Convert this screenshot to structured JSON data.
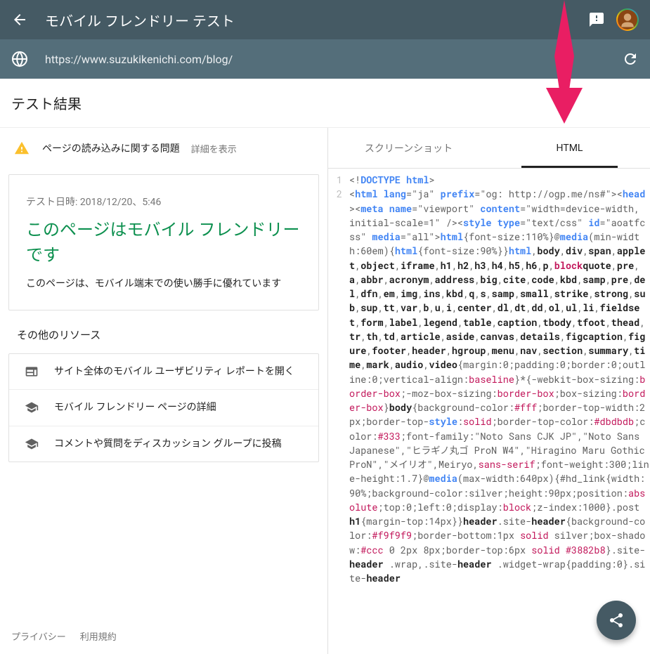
{
  "header": {
    "title": "モバイル フレンドリー テスト"
  },
  "url": "https://www.suzukikenichi.com/blog/",
  "result_header": "テスト結果",
  "warning": {
    "label": "ページの読み込みに関する問題",
    "details": "詳細を表示"
  },
  "card": {
    "date": "テスト日時: 2018/12/20、5:46",
    "msg": "このページはモバイル フレンドリーです",
    "desc": "このページは、モバイル端末での使い勝手に優れています"
  },
  "resources_title": "その他のリソース",
  "resources": [
    "サイト全体のモバイル ユーザビリティ レポートを開く",
    "モバイル フレンドリー ページの詳細",
    "コメントや質問をディスカッション グループに投稿"
  ],
  "footer": {
    "privacy": "プライバシー",
    "tos": "利用規約"
  },
  "tabs": {
    "screenshot": "スクリーンショット",
    "html": "HTML"
  },
  "code_lines": [
    "1",
    "2"
  ],
  "source_preview": "<!DOCTYPE html>\n<html lang=\"ja\" prefix=\"og: http://ogp.me/ns#\"><head><meta name=\"viewport\" content=\"width=device-width, initial-scale=1\" /><style type=\"text/css\" id=\"aoatfcss\" media=\"all\">html{font-size:110%}@media(min-width:60em){html{font-size:90%}}html,body,div,span,applet,object,iframe,h1,h2,h3,h4,h5,h6,p,blockquote,pre,a,abbr,acronym,address,big,cite,code,kbd,samp,pre,del,dfn,em,img,ins,kbd,q,s,samp,small,strike,strong,sub,sup,tt,var,b,u,i,center,dl,dt,dd,ol,ul,li,fieldset,form,label,legend,table,caption,tbody,tfoot,thead,tr,th,td,article,aside,canvas,details,figcaption,figure,footer,header,hgroup,menu,nav,section,summary,time,mark,audio,video{margin:0;padding:0;border:0;outline:0;vertical-align:baseline}*{-webkit-box-sizing:border-box;-moz-box-sizing:border-box;box-sizing:border-box}body{background-color:#fff;border-top-width:2px;border-top-style:solid;border-top-color:#dbdbdb;color:#333;font-family:\"Noto Sans CJK JP\",\"Noto Sans Japanese\",\"ヒラギノ丸ゴ ProN W4\",\"Hiragino Maru Gothic ProN\",\"メイリオ\",Meiryo,sans-serif;font-weight:300;line-height:1.7}@media(max-width:640px){#hd_link{width:90%;background-color:silver;height:90px;position:absolute;top:0;left:0;display:block;z-index:1000}.post h1{margin-top:14px}}header.site-header{background-color:#f9f9f9;border-bottom:1px solid silver;box-shadow:#ccc 0 2px 8px;border-top:6px solid #3882b8}.site-header .wrap,.site-header .widget-wrap{padding:0}.site-header"
}
